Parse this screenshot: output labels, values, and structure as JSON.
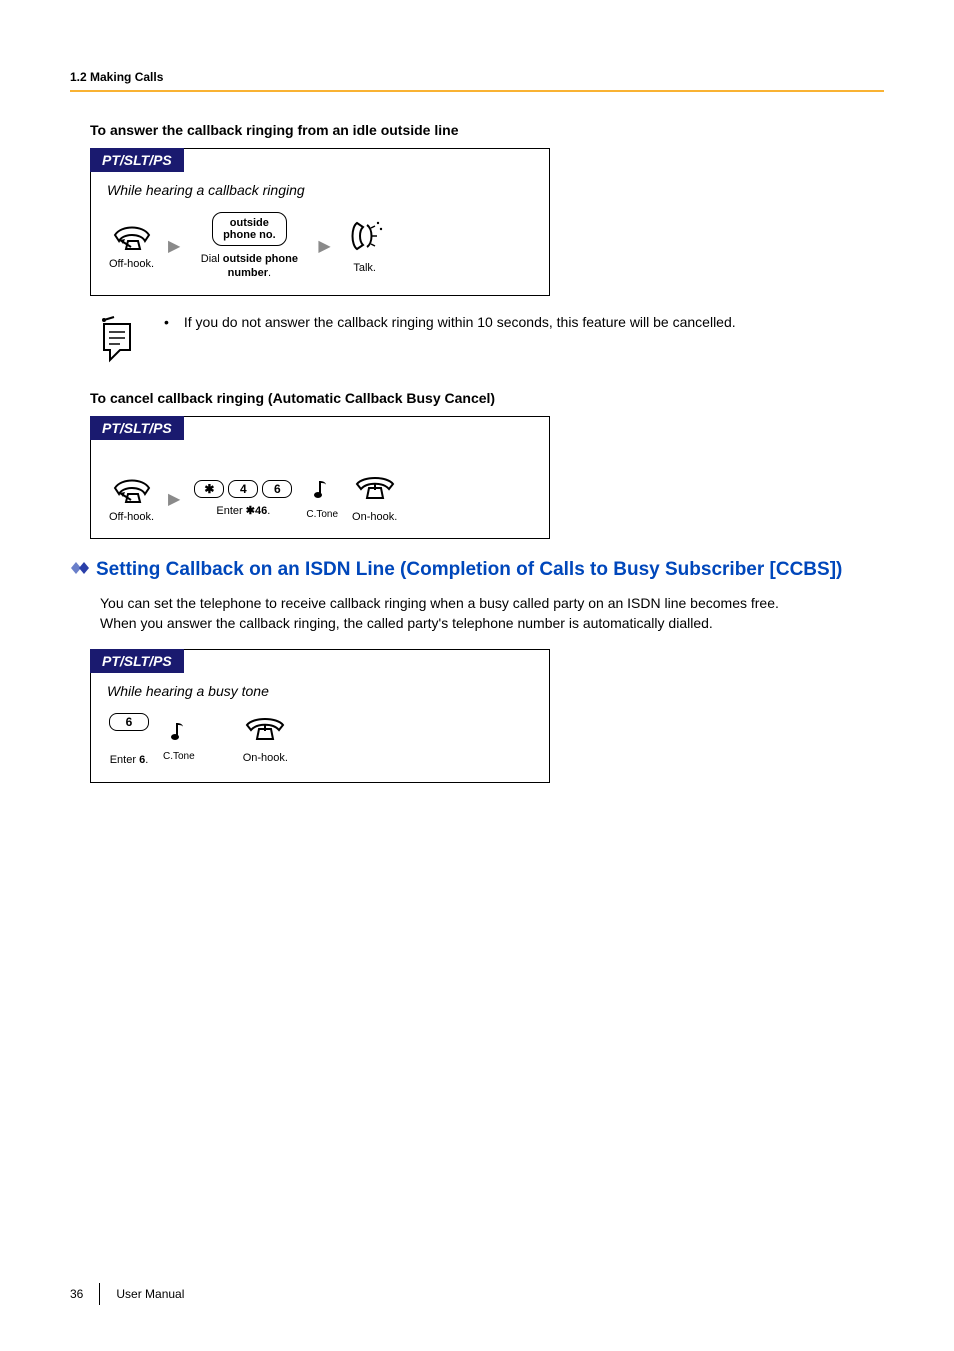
{
  "breadcrumb": "1.2 Making Calls",
  "heading1": "To answer the callback ringing from an idle outside line",
  "pill": "PT/SLT/PS",
  "proc1": {
    "context": "While hearing a callback ringing",
    "offhook": "Off-hook.",
    "input_line1": "outside",
    "input_line2": "phone no.",
    "dial_caption_prefix": "Dial ",
    "dial_caption_bold": "outside phone number",
    "dial_caption_suffix": ".",
    "talk": "Talk."
  },
  "note": {
    "bullet": "•",
    "text": "If you do not answer the callback ringing within 10 seconds, this feature will be cancelled."
  },
  "heading2": "To cancel callback ringing (Automatic Callback Busy Cancel)",
  "proc2": {
    "offhook": "Off-hook.",
    "keys": [
      "✱",
      "4",
      "6"
    ],
    "ctone": "C.Tone",
    "enter_prefix": "Enter ",
    "enter_code": "✱46",
    "enter_suffix": ".",
    "onhook": "On-hook."
  },
  "section_title": "Setting Callback on an ISDN Line (Completion of Calls to Busy Subscriber [CCBS])",
  "section_body_1": "You can set the telephone to receive callback ringing when a busy called party on an ISDN line becomes free.",
  "section_body_2": "When you answer the callback ringing, the called party's telephone number is automatically dialled.",
  "proc3": {
    "context": "While hearing a busy tone",
    "key": "6",
    "ctone": "C.Tone",
    "enter_prefix": "Enter ",
    "enter_code": "6",
    "enter_suffix": ".",
    "onhook": "On-hook."
  },
  "footer": {
    "page": "36",
    "label": "User Manual"
  }
}
